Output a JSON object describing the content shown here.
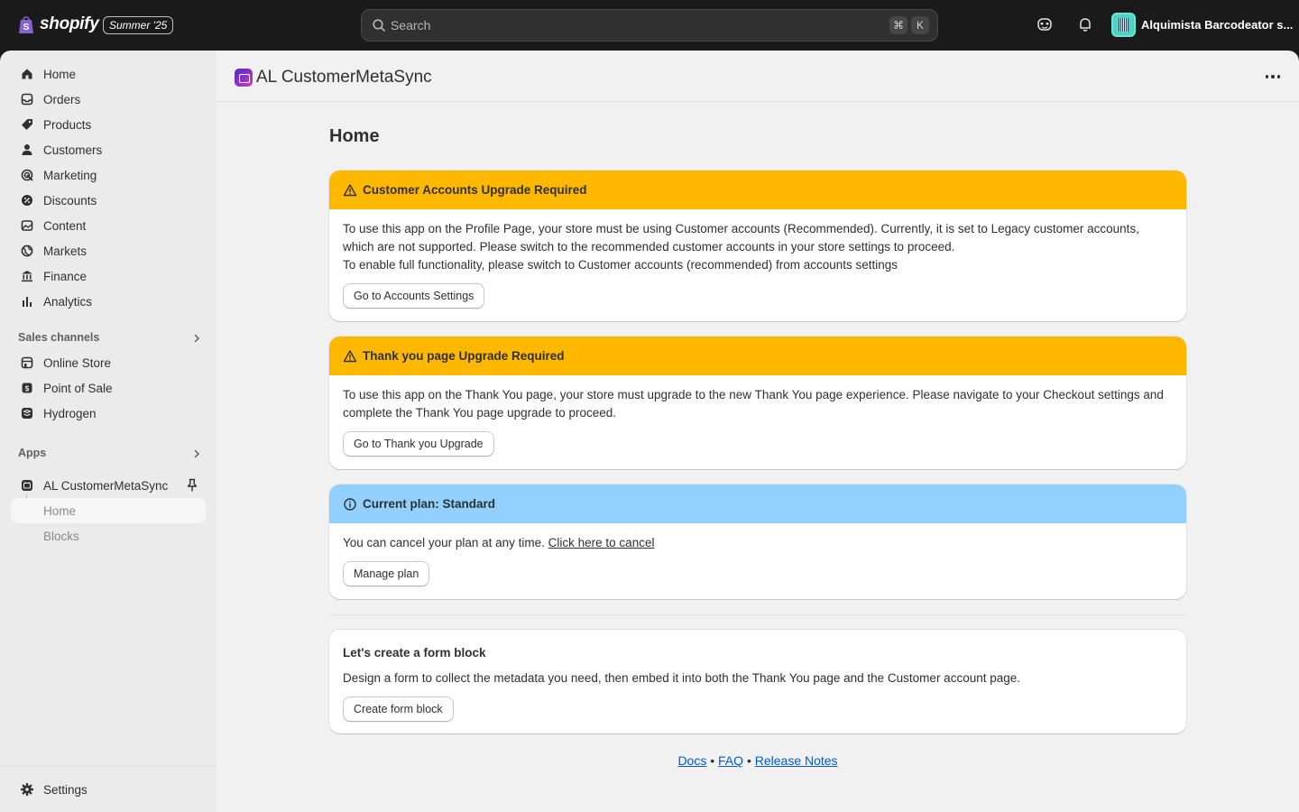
{
  "topbar": {
    "logo_text": "shopify",
    "edition_badge": "Summer '25",
    "search_placeholder": "Search",
    "shortcut_keys": [
      "⌘",
      "K"
    ],
    "store_name": "Alquimista Barcodeator s..."
  },
  "sidebar": {
    "main_items": [
      {
        "label": "Home",
        "icon": "home-icon"
      },
      {
        "label": "Orders",
        "icon": "inbox-icon"
      },
      {
        "label": "Products",
        "icon": "tag-icon"
      },
      {
        "label": "Customers",
        "icon": "person-icon"
      },
      {
        "label": "Marketing",
        "icon": "target-icon"
      },
      {
        "label": "Discounts",
        "icon": "discount-icon"
      },
      {
        "label": "Content",
        "icon": "image-icon"
      },
      {
        "label": "Markets",
        "icon": "globe-icon"
      },
      {
        "label": "Finance",
        "icon": "bank-icon"
      },
      {
        "label": "Analytics",
        "icon": "bar-chart-icon"
      }
    ],
    "sales_channels_label": "Sales channels",
    "sales_channels": [
      {
        "label": "Online Store",
        "icon": "store-icon"
      },
      {
        "label": "Point of Sale",
        "icon": "pos-icon"
      },
      {
        "label": "Hydrogen",
        "icon": "hydrogen-icon"
      }
    ],
    "apps_label": "Apps",
    "app_name": "AL CustomerMetaSync",
    "app_subitems": [
      "Home",
      "Blocks"
    ],
    "settings_label": "Settings"
  },
  "main": {
    "app_title": "AL CustomerMetaSync",
    "page_title": "Home",
    "banners": [
      {
        "tone": "warning",
        "title": "Customer Accounts Upgrade Required",
        "line1": "To use this app on the Profile Page, your store must be using Customer accounts (Recommended). Currently, it is set to Legacy customer accounts, which are not supported. Please switch to the recommended customer accounts in your store settings to proceed.",
        "line2": "To enable full functionality, please switch to Customer accounts (recommended) from accounts settings",
        "button": "Go to Accounts Settings"
      },
      {
        "tone": "warning",
        "title": "Thank you page Upgrade Required",
        "line1": "To use this app on the Thank You page, your store must upgrade to the new Thank You page experience. Please navigate to your Checkout settings and complete the Thank You page upgrade to proceed.",
        "button": "Go to Thank you Upgrade"
      },
      {
        "tone": "info",
        "title": "Current plan: Standard",
        "text": "You can cancel your plan at any time.",
        "link": "Click here to cancel",
        "button": "Manage plan"
      }
    ],
    "form_card": {
      "title": "Let's create a form block",
      "text": "Design a form to collect the metadata you need, then embed it into both the Thank You page and the Customer account page.",
      "button": "Create form block"
    },
    "footer_links": [
      "Docs",
      "FAQ",
      "Release Notes"
    ],
    "footer_separator": "•"
  },
  "colors": {
    "topbar_bg": "#1a1a1a",
    "warning_banner": "#ffb800",
    "info_banner": "#91d0ff",
    "link": "#005bd3"
  }
}
